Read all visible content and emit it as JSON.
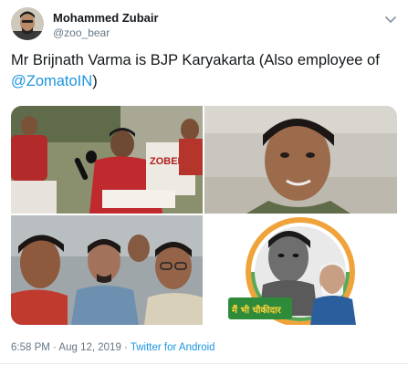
{
  "author": {
    "display_name": "Mohammed Zubair",
    "handle": "@zoo_bear"
  },
  "tweet": {
    "text_before_mention": "Mr Brijnath Varma is BJP Karyakarta (Also employee of ",
    "mention": "@ZomatoIN",
    "text_after_mention": ")",
    "photos": [
      {
        "sign_text": "ZOBEER"
      },
      {},
      {},
      {
        "logo_text": "मैं भी चौकीदार"
      }
    ]
  },
  "meta": {
    "timestamp": "6:58 PM · Aug 12, 2019",
    "separator": " · ",
    "client": "Twitter for Android"
  },
  "colors": {
    "link": "#1b95e0",
    "secondary_text": "#657786"
  },
  "icons": {
    "menu": "chevron-down-icon"
  }
}
